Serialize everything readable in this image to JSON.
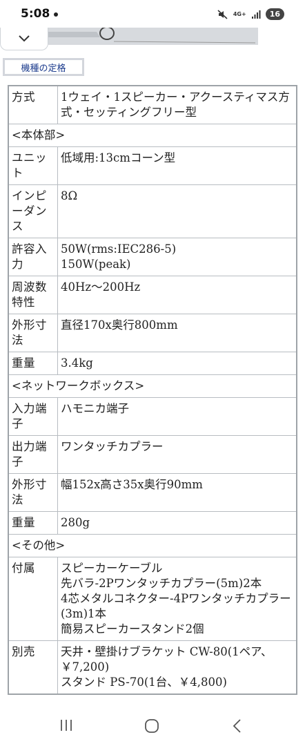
{
  "status": {
    "time": "5:08",
    "battery": "16",
    "network": "4G+"
  },
  "spec_button": "機種の定格",
  "rows": [
    {
      "key": "方式",
      "value": "1ウェイ・1スピーカー・アクースティマス方式・セッティングフリー型"
    },
    {
      "section": "<本体部>"
    },
    {
      "key": "ユニット",
      "value": "低域用:13cmコーン型"
    },
    {
      "key": "インピーダンス",
      "value": "8Ω"
    },
    {
      "key": "許容入力",
      "value": "50W(rms:IEC286-5)\n150W(peak)"
    },
    {
      "key": "周波数特性",
      "value": "40Hz～200Hz"
    },
    {
      "key": "外形寸法",
      "value": "直径170x奥行800mm"
    },
    {
      "key": "重量",
      "value": "3.4kg"
    },
    {
      "section": "<ネットワークボックス>"
    },
    {
      "key": "入力端子",
      "value": "ハモニカ端子"
    },
    {
      "key": "出力端子",
      "value": "ワンタッチカプラー"
    },
    {
      "key": "外形寸法",
      "value": "幅152x高さ35x奥行90mm"
    },
    {
      "key": "重量",
      "value": "280g"
    },
    {
      "section": "<その他>"
    },
    {
      "key": "付属",
      "value": "スピーカーケーブル\n先バラ-2Pワンタッチカプラー(5m)2本\n4芯メタルコネクター-4Pワンタッチカプラー(3m)1本\n簡易スピーカースタンド2個"
    },
    {
      "key": "別売",
      "value": "天井・壁掛けブラケット CW-80(1ペア、￥7,200)\nスタンド PS-70(1台、￥4,800)"
    }
  ]
}
